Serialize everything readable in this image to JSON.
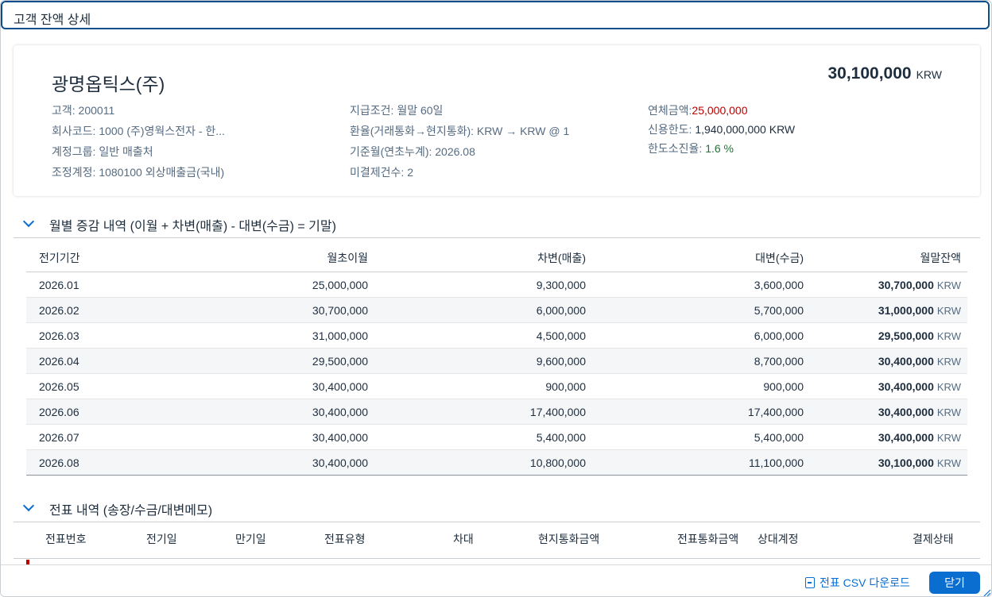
{
  "dialog": {
    "title": "고객 잔액 상세"
  },
  "customer": {
    "name": "광명옵틱스(주)",
    "balance": "30,100,000",
    "balance_currency": "KRW",
    "col1": [
      {
        "label": "고객:",
        "value": "200011"
      },
      {
        "label": "회사코드:",
        "value": "1000 (주)영웍스전자 - 한..."
      },
      {
        "label": "계정그룹:",
        "value": "일반 매출처"
      },
      {
        "label": "조정계정:",
        "value": "1080100 외상매출금(국내)"
      }
    ],
    "col2": [
      {
        "label": "지급조건:",
        "value": "월말 60일"
      },
      {
        "label": "환율(거래통화→현지통화):",
        "value": "KRW → KRW @ 1"
      },
      {
        "label": "기준월(연초누계):",
        "value": "2026.08"
      },
      {
        "label": "미결제건수:",
        "value": "2"
      }
    ],
    "col3": [
      {
        "label": "연체금액:",
        "value": "25,000,000"
      },
      {
        "label": "신용한도:",
        "value": "1,940,000,000 KRW"
      },
      {
        "label": "한도소진율:",
        "value": "1.6 %"
      }
    ]
  },
  "monthly": {
    "title": "월별 증감 내역 (이월 + 차변(매출) - 대변(수금) = 기말)",
    "headers": [
      "전기기간",
      "월초이월",
      "차변(매출)",
      "대변(수금)",
      "월말잔액"
    ],
    "currency": "KRW",
    "rows": [
      [
        "2026.01",
        "25,000,000",
        "9,300,000",
        "3,600,000",
        "30,700,000"
      ],
      [
        "2026.02",
        "30,700,000",
        "6,000,000",
        "5,700,000",
        "31,000,000"
      ],
      [
        "2026.03",
        "31,000,000",
        "4,500,000",
        "6,000,000",
        "29,500,000"
      ],
      [
        "2026.04",
        "29,500,000",
        "9,600,000",
        "8,700,000",
        "30,400,000"
      ],
      [
        "2026.05",
        "30,400,000",
        "900,000",
        "900,000",
        "30,400,000"
      ],
      [
        "2026.06",
        "30,400,000",
        "17,400,000",
        "17,400,000",
        "30,400,000"
      ],
      [
        "2026.07",
        "30,400,000",
        "5,400,000",
        "5,400,000",
        "30,400,000"
      ],
      [
        "2026.08",
        "30,400,000",
        "10,800,000",
        "11,100,000",
        "30,100,000"
      ]
    ]
  },
  "vouchers": {
    "title": "전표 내역 (송장/수금/대변메모)",
    "headers": [
      "전표번호",
      "전기일",
      "만기일",
      "전표유형",
      "차대",
      "현지통화금액",
      "전표통화금액",
      "상대계정",
      "결제상태"
    ]
  },
  "footer": {
    "csv_label": "전표 CSV 다운로드",
    "close_label": "닫기"
  },
  "colors": {
    "accent": "#0a6ed1",
    "overdue": "#bb0000",
    "usage": "#256f3a"
  }
}
